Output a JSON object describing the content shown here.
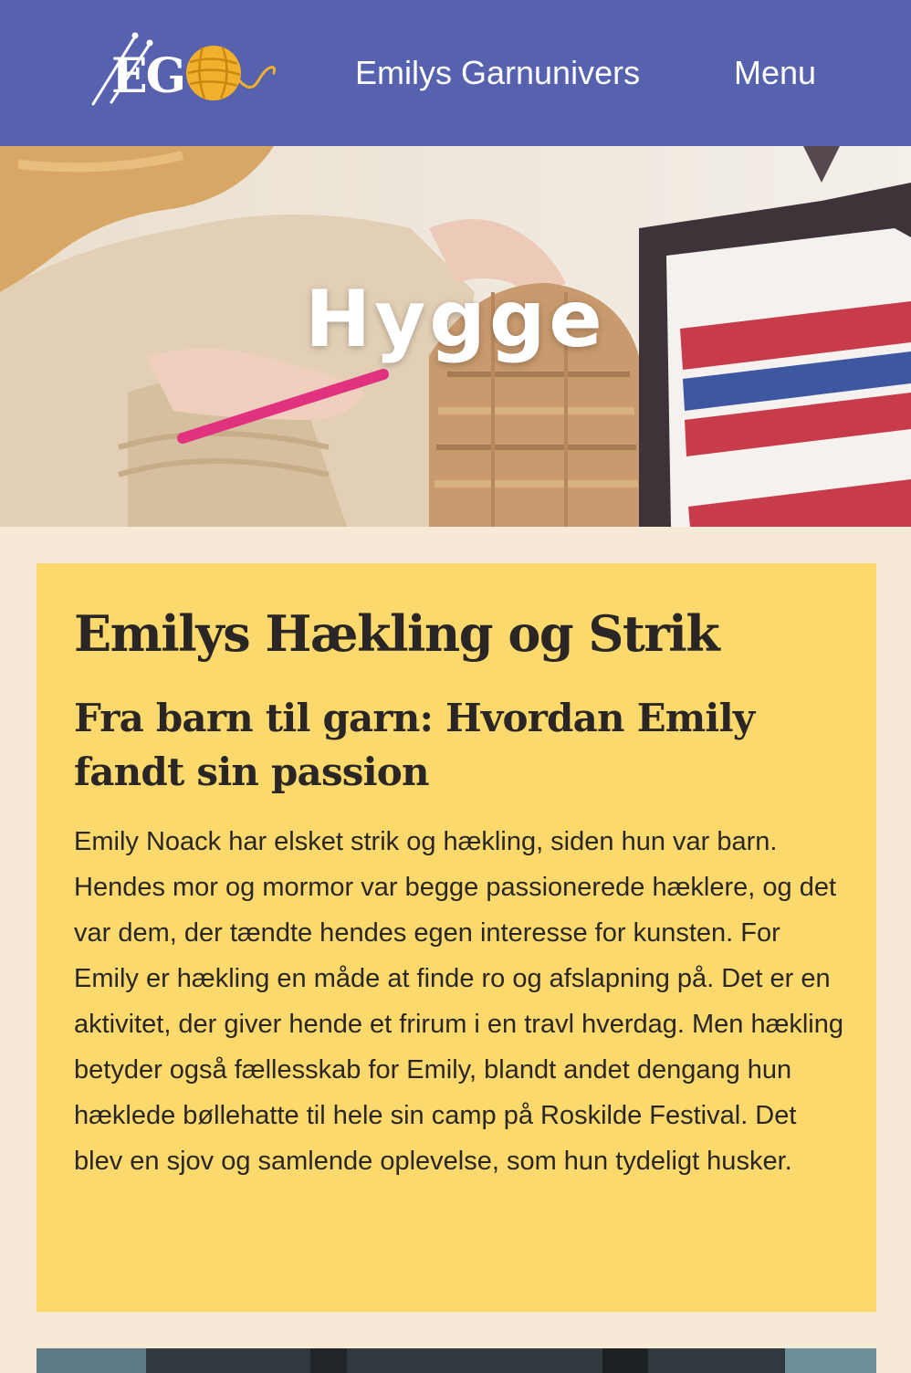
{
  "header": {
    "logo_text": "EG",
    "site_title": "Emilys Garnunivers",
    "menu_label": "Menu",
    "background_color": "#5662ae"
  },
  "hero": {
    "title": "Hygge"
  },
  "article": {
    "title": "Emilys Hækling og Strik",
    "subtitle": "Fra barn til garn: Hvordan Emily fandt sin passion",
    "body": "Emily Noack har elsket strik og hækling, siden hun var barn. Hendes mor og mormor var begge passionerede hæklere, og det var dem, der tændte hendes egen interesse for kunsten. For Emily er hækling en måde at finde ro og afslapning på. Det er en aktivitet, der giver hende et frirum i en travl hverdag. Men hækling betyder også fællesskab for Emily, blandt andet dengang hun hæklede bøllehatte til hele sin camp på Roskilde Festival. Det blev en sjov og samlende oplevelse, som hun tydeligt husker.",
    "card_color": "#fbd96c"
  },
  "colors": {
    "page_background": "#f6ead6",
    "text": "#2b2626",
    "accent_yarn": "#f2b12c"
  }
}
